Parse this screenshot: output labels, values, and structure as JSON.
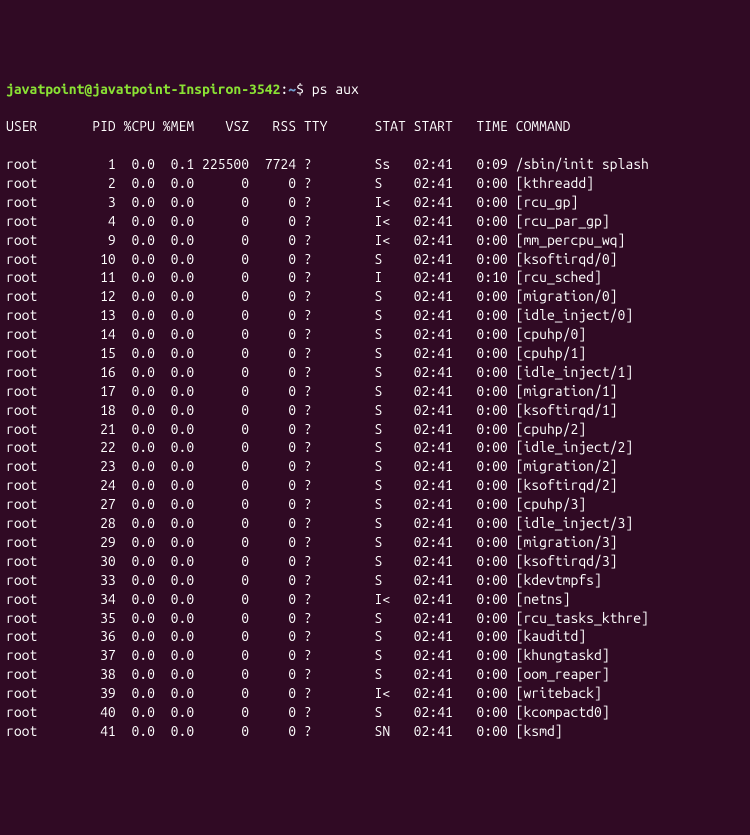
{
  "prompt": {
    "user_host": "javatpoint@javatpoint-Inspiron-3542",
    "colon": ":",
    "path": "~",
    "dollar": "$ ",
    "command": "ps aux"
  },
  "header": "USER       PID %CPU %MEM    VSZ   RSS TTY      STAT START   TIME COMMAND",
  "rows": [
    "root         1  0.0  0.1 225500  7724 ?        Ss   02:41   0:09 /sbin/init splash",
    "root         2  0.0  0.0      0     0 ?        S    02:41   0:00 [kthreadd]",
    "root         3  0.0  0.0      0     0 ?        I<   02:41   0:00 [rcu_gp]",
    "root         4  0.0  0.0      0     0 ?        I<   02:41   0:00 [rcu_par_gp]",
    "root         9  0.0  0.0      0     0 ?        I<   02:41   0:00 [mm_percpu_wq]",
    "root        10  0.0  0.0      0     0 ?        S    02:41   0:00 [ksoftirqd/0]",
    "root        11  0.0  0.0      0     0 ?        I    02:41   0:10 [rcu_sched]",
    "root        12  0.0  0.0      0     0 ?        S    02:41   0:00 [migration/0]",
    "root        13  0.0  0.0      0     0 ?        S    02:41   0:00 [idle_inject/0]",
    "root        14  0.0  0.0      0     0 ?        S    02:41   0:00 [cpuhp/0]",
    "root        15  0.0  0.0      0     0 ?        S    02:41   0:00 [cpuhp/1]",
    "root        16  0.0  0.0      0     0 ?        S    02:41   0:00 [idle_inject/1]",
    "root        17  0.0  0.0      0     0 ?        S    02:41   0:00 [migration/1]",
    "root        18  0.0  0.0      0     0 ?        S    02:41   0:00 [ksoftirqd/1]",
    "root        21  0.0  0.0      0     0 ?        S    02:41   0:00 [cpuhp/2]",
    "root        22  0.0  0.0      0     0 ?        S    02:41   0:00 [idle_inject/2]",
    "root        23  0.0  0.0      0     0 ?        S    02:41   0:00 [migration/2]",
    "root        24  0.0  0.0      0     0 ?        S    02:41   0:00 [ksoftirqd/2]",
    "root        27  0.0  0.0      0     0 ?        S    02:41   0:00 [cpuhp/3]",
    "root        28  0.0  0.0      0     0 ?        S    02:41   0:00 [idle_inject/3]",
    "root        29  0.0  0.0      0     0 ?        S    02:41   0:00 [migration/3]",
    "root        30  0.0  0.0      0     0 ?        S    02:41   0:00 [ksoftirqd/3]",
    "root        33  0.0  0.0      0     0 ?        S    02:41   0:00 [kdevtmpfs]",
    "root        34  0.0  0.0      0     0 ?        I<   02:41   0:00 [netns]",
    "root        35  0.0  0.0      0     0 ?        S    02:41   0:00 [rcu_tasks_kthre]",
    "root        36  0.0  0.0      0     0 ?        S    02:41   0:00 [kauditd]",
    "root        37  0.0  0.0      0     0 ?        S    02:41   0:00 [khungtaskd]",
    "root        38  0.0  0.0      0     0 ?        S    02:41   0:00 [oom_reaper]",
    "root        39  0.0  0.0      0     0 ?        I<   02:41   0:00 [writeback]",
    "root        40  0.0  0.0      0     0 ?        S    02:41   0:00 [kcompactd0]",
    "root        41  0.0  0.0      0     0 ?        SN   02:41   0:00 [ksmd]"
  ]
}
